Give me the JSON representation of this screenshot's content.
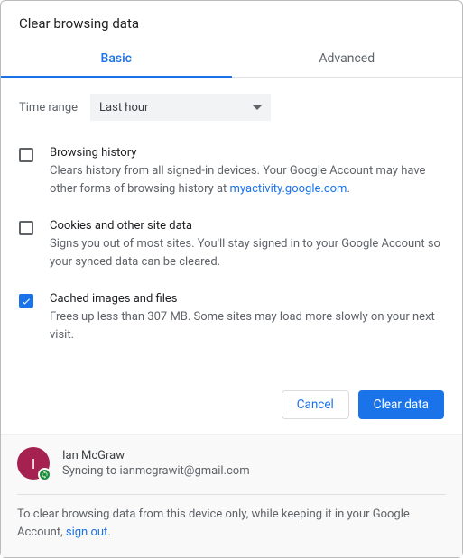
{
  "title": "Clear browsing data",
  "tabs": {
    "basic": "Basic",
    "advanced": "Advanced"
  },
  "time": {
    "label": "Time range",
    "value": "Last hour"
  },
  "options": {
    "history": {
      "title": "Browsing history",
      "desc_pre": "Clears history from all signed-in devices. Your Google Account may have other forms of browsing history at ",
      "link": "myactivity.google.com",
      "desc_post": ".",
      "checked": false
    },
    "cookies": {
      "title": "Cookies and other site data",
      "desc": "Signs you out of most sites. You'll stay signed in to your Google Account so your synced data can be cleared.",
      "checked": false
    },
    "cache": {
      "title": "Cached images and files",
      "desc": "Frees up less than 307 MB. Some sites may load more slowly on your next visit.",
      "checked": true
    }
  },
  "buttons": {
    "cancel": "Cancel",
    "clear": "Clear data"
  },
  "user": {
    "initial": "I",
    "name": "Ian McGraw",
    "sync": "Syncing to ianmcgrawit@gmail.com"
  },
  "footer": {
    "pre": "To clear browsing data from this device only, while keeping it in your Google Account, ",
    "link": "sign out",
    "post": "."
  }
}
